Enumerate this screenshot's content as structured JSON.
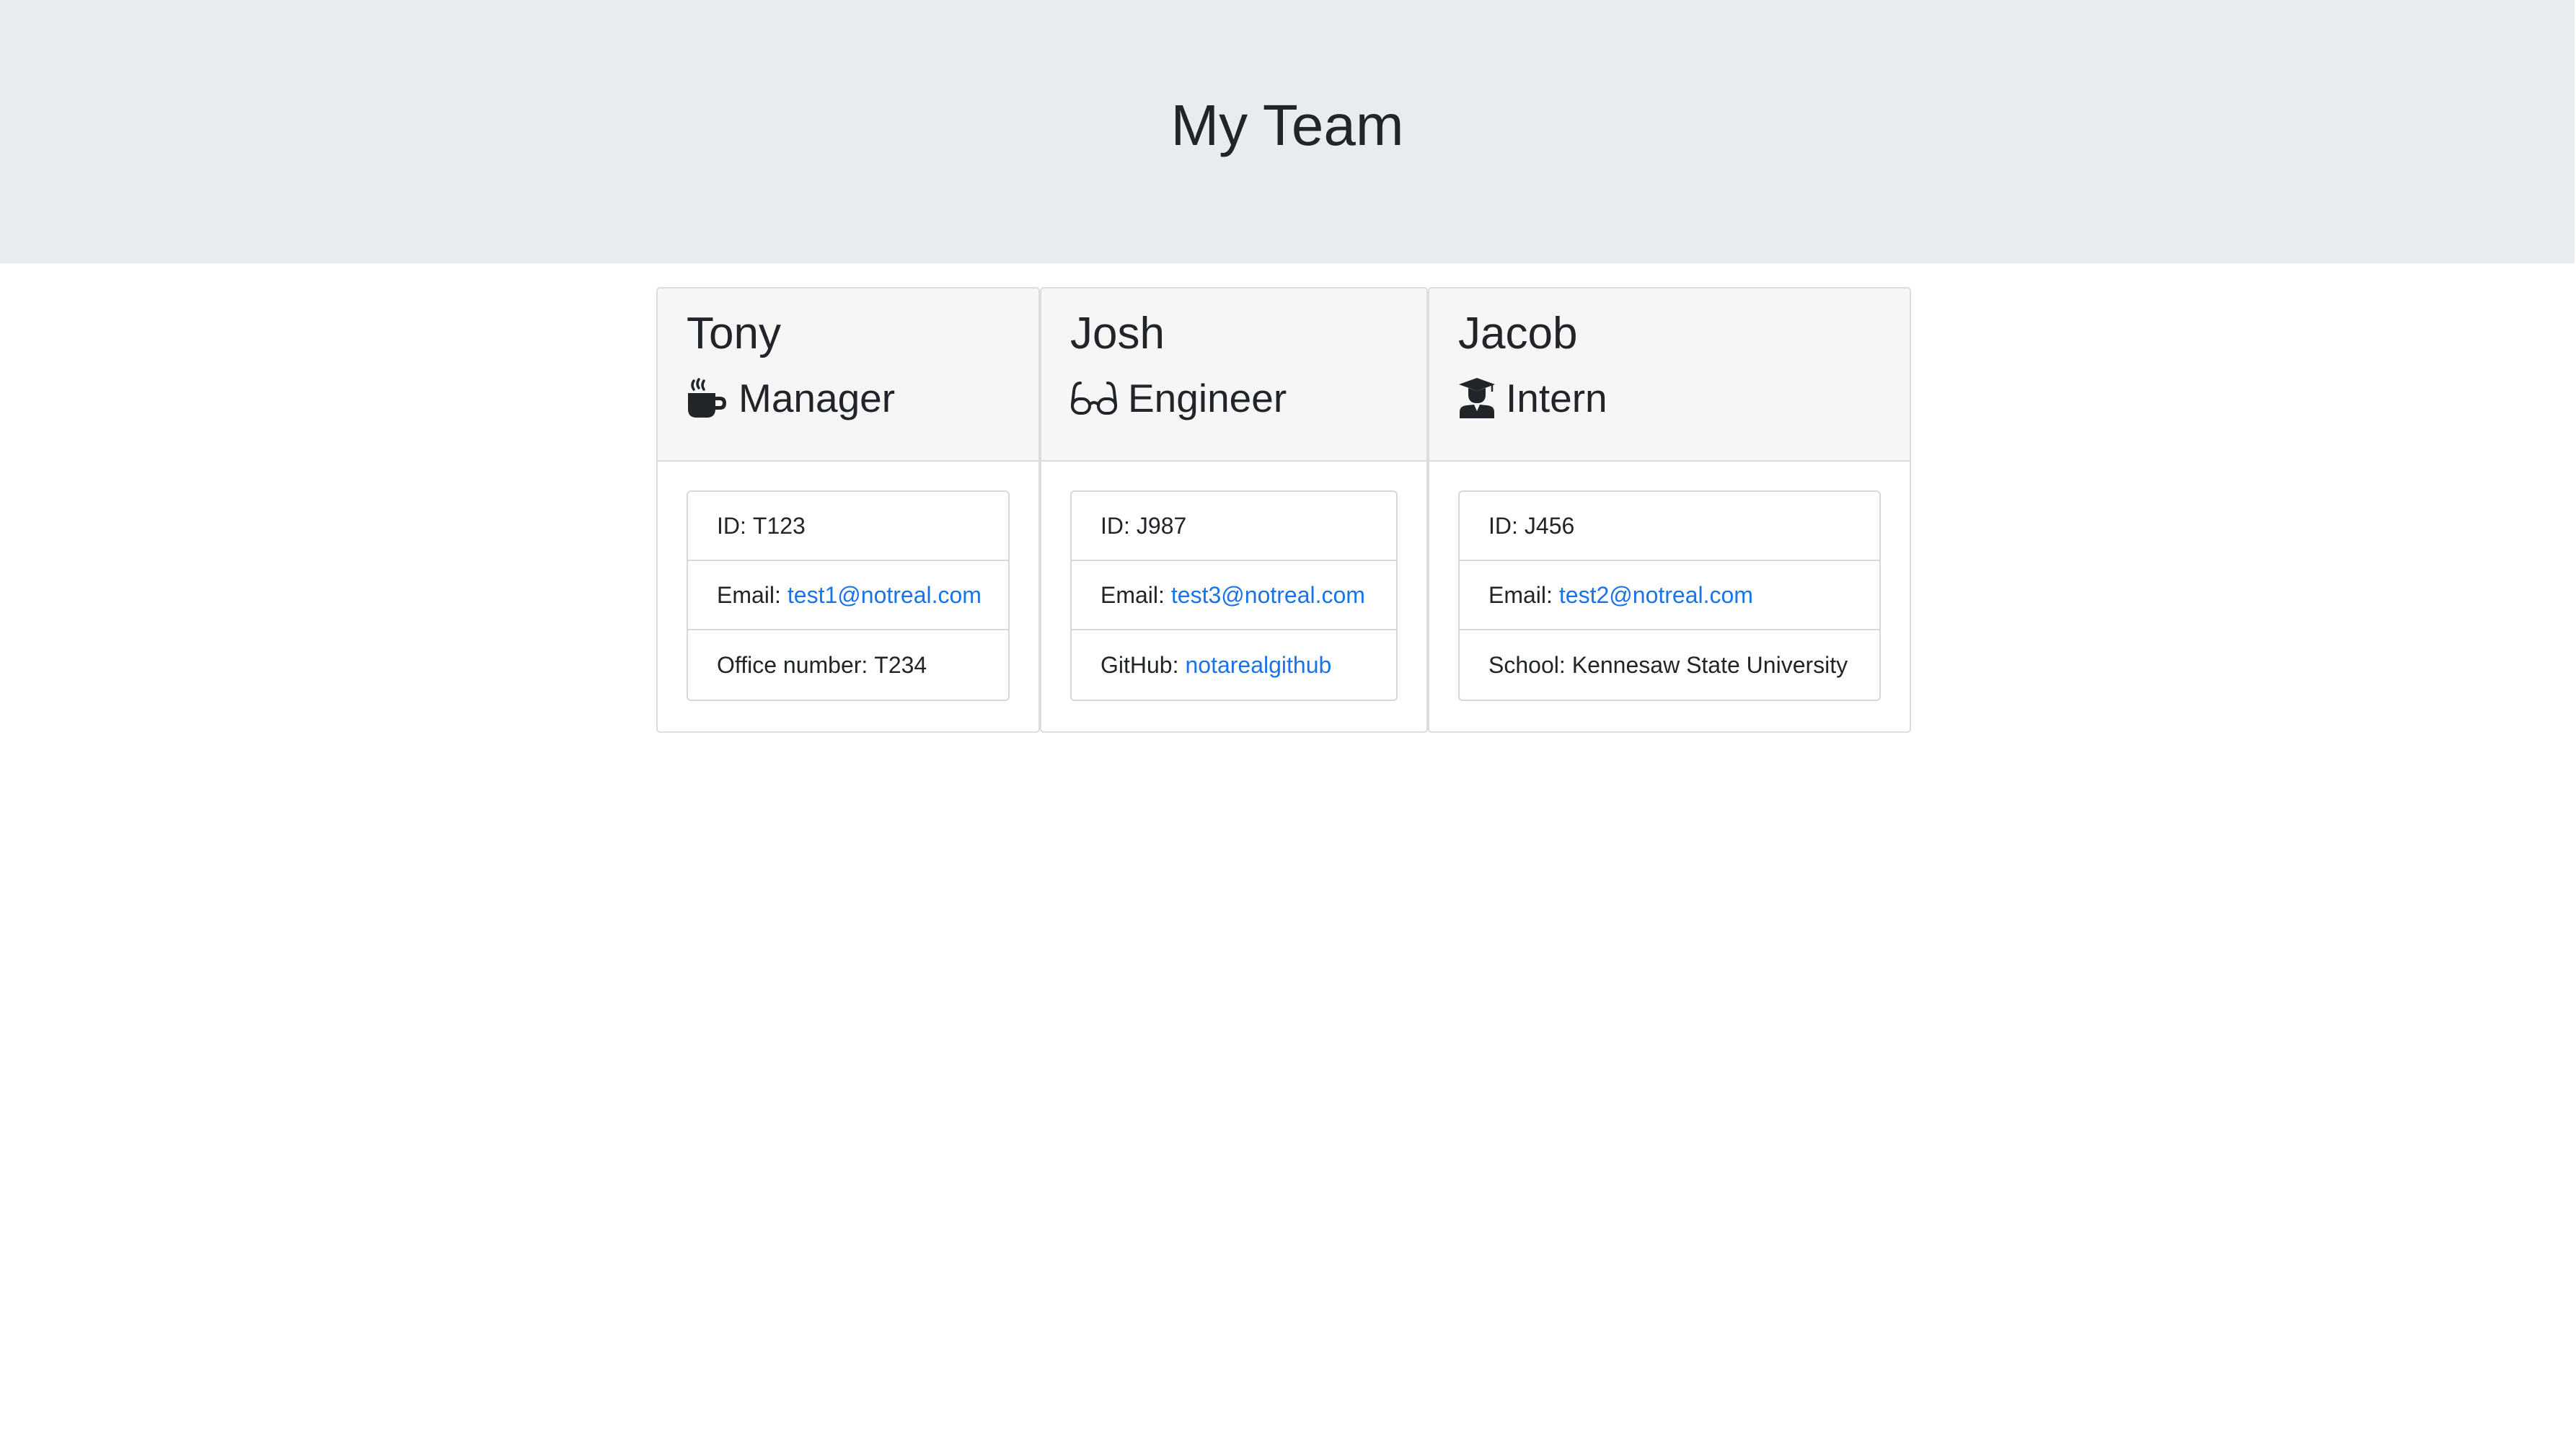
{
  "header": {
    "title": "My Team"
  },
  "colors": {
    "jumbotron_bg": "#e9ecef",
    "card_header_bg": "#f6f6f6",
    "link": "#1a73e8",
    "text": "#212529"
  },
  "team": [
    {
      "name": "Tony",
      "role": "Manager",
      "role_icon": "coffee-mug-icon",
      "id_label": "ID:",
      "id": "T123",
      "email_label": "Email:",
      "email": "test1@notreal.com",
      "extra_label": "Office number:",
      "extra_value": "T234"
    },
    {
      "name": "Josh",
      "role": "Engineer",
      "role_icon": "glasses-icon",
      "id_label": "ID:",
      "id": "J987",
      "email_label": "Email:",
      "email": "test3@notreal.com",
      "extra_label": "GitHub:",
      "extra_value": "notarealgithub"
    },
    {
      "name": "Jacob",
      "role": "Intern",
      "role_icon": "graduate-icon",
      "id_label": "ID:",
      "id": "J456",
      "email_label": "Email:",
      "email": "test2@notreal.com",
      "extra_label": "School:",
      "extra_value": "Kennesaw State University"
    }
  ]
}
